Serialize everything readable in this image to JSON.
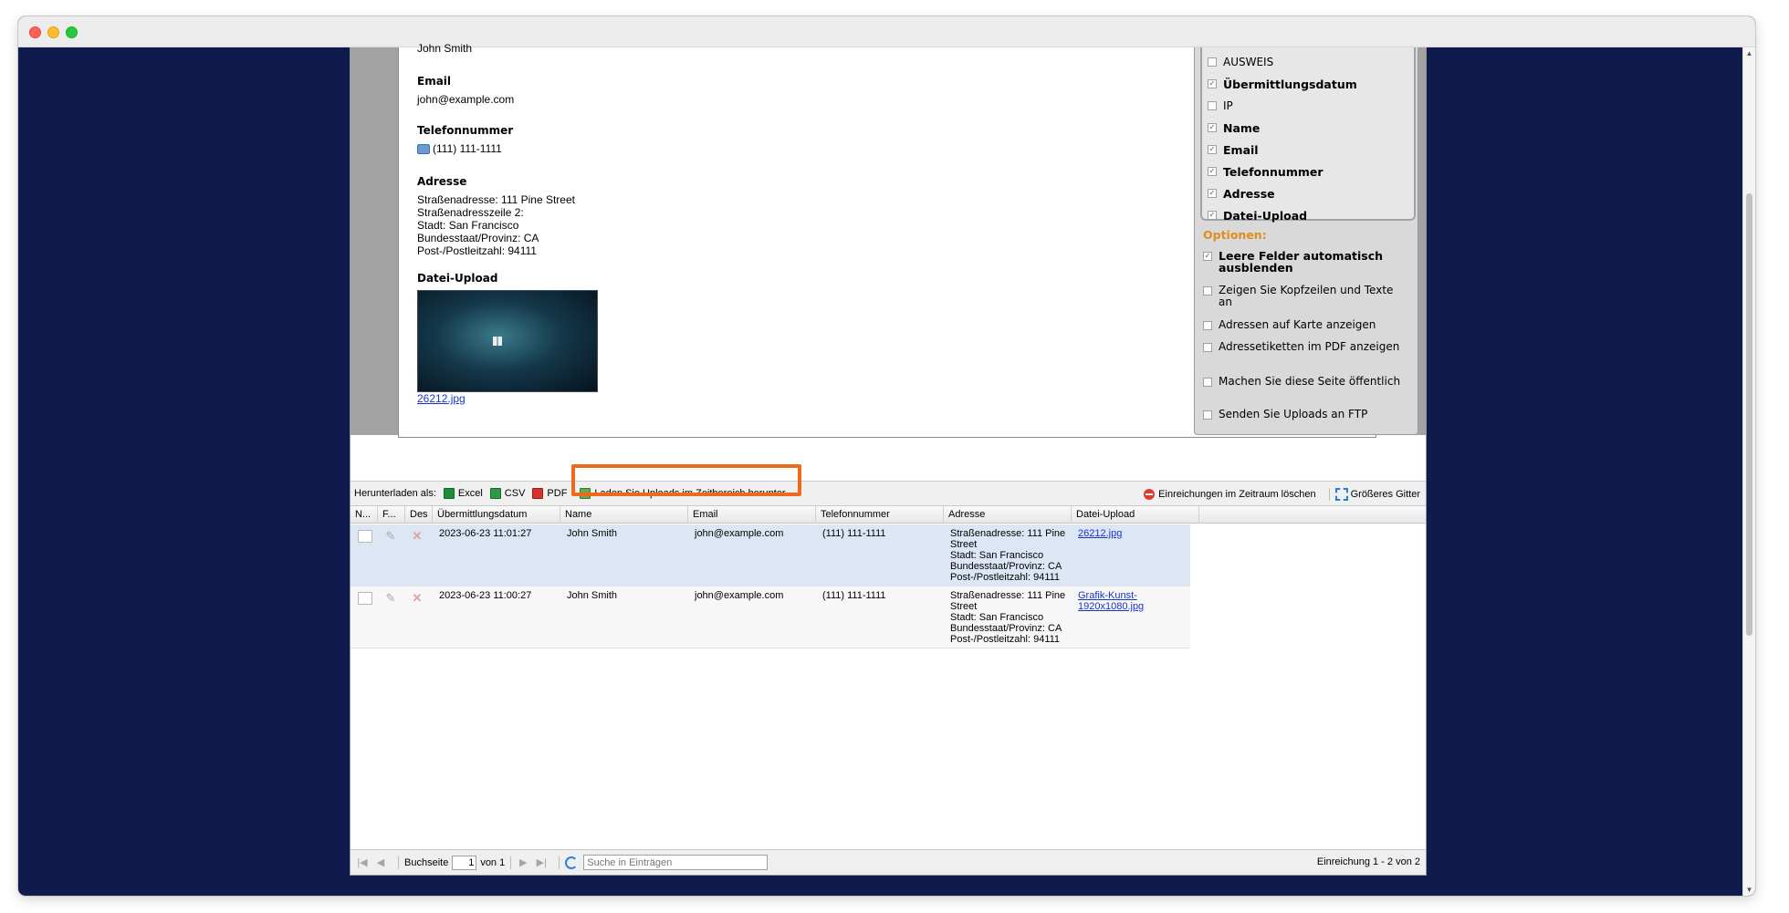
{
  "preview": {
    "name_fragment": "John Smith",
    "fields": [
      {
        "label": "Email",
        "lines": [
          "john@example.com"
        ]
      },
      {
        "label": "Telefonnummer",
        "lines": [
          "(111) 111-1111"
        ]
      },
      {
        "label": "Adresse",
        "lines": [
          "Straßenadresse: 111 Pine Street",
          "Straßenadresszeile 2:",
          "Stadt: San Francisco",
          "Bundesstaat/Provinz: CA",
          "Post-/Postleitzahl: 94111"
        ]
      },
      {
        "label": "Datei-Upload",
        "file_link": "26212.jpg"
      }
    ]
  },
  "side_panel": {
    "fields": [
      {
        "label": "AUSWEIS",
        "checked": false,
        "bold": false
      },
      {
        "label": "Übermittlungsdatum",
        "checked": true,
        "bold": true
      },
      {
        "label": "IP",
        "checked": false,
        "bold": false
      },
      {
        "label": "Name",
        "checked": true,
        "bold": true
      },
      {
        "label": "Email",
        "checked": true,
        "bold": true
      },
      {
        "label": "Telefonnummer",
        "checked": true,
        "bold": true
      },
      {
        "label": "Adresse",
        "checked": true,
        "bold": true
      },
      {
        "label": "Datei-Upload",
        "checked": true,
        "bold": true
      }
    ],
    "options_title": "Optionen:",
    "options": [
      {
        "label": "Leere Felder automatisch ausblenden",
        "checked": true,
        "bold": true
      },
      {
        "label": "Zeigen Sie Kopfzeilen und Texte an",
        "checked": false,
        "bold": false
      },
      {
        "label": "Adressen auf Karte anzeigen",
        "checked": false,
        "bold": false
      },
      {
        "label": "Adressetiketten im PDF anzeigen",
        "checked": false,
        "bold": false
      },
      {
        "label": "Machen Sie diese Seite öffentlich",
        "checked": false,
        "bold": false
      },
      {
        "label": "Senden Sie Uploads an FTP",
        "checked": false,
        "bold": false
      }
    ]
  },
  "toolbar": {
    "download_label": "Herunterladen als:",
    "excel": "Excel",
    "csv": "CSV",
    "pdf": "PDF",
    "uploads": "Laden Sie Uploads im Zeitbereich herunter",
    "delete": "Einreichungen im Zeitraum löschen",
    "bigger_grid": "Größeres Gitter"
  },
  "grid": {
    "columns": [
      "N...",
      "F...",
      "Des",
      "Übermittlungsdatum",
      "Name",
      "Email",
      "Telefonnummer",
      "Adresse",
      "Datei-Upload"
    ],
    "rows": [
      {
        "date": "2023-06-23 11:01:27",
        "name": "John Smith",
        "email": "john@example.com",
        "phone": "(111) 111-1111",
        "address": [
          "Straßenadresse: 111 Pine",
          "Street",
          "Stadt: San Francisco",
          "Bundesstaat/Provinz: CA",
          "Post-/Postleitzahl: 94111"
        ],
        "file": [
          "26212.jpg"
        ]
      },
      {
        "date": "2023-06-23 11:00:27",
        "name": "John Smith",
        "email": "john@example.com",
        "phone": "(111) 111-1111",
        "address": [
          "Straßenadresse: 111 Pine",
          "Street",
          "Stadt: San Francisco",
          "Bundesstaat/Provinz: CA",
          "Post-/Postleitzahl: 94111"
        ],
        "file": [
          "Grafik-Kunst-",
          "1920x1080.jpg"
        ]
      }
    ]
  },
  "pager": {
    "page_label": "Buchseite",
    "page_value": "1",
    "of_label": "von 1",
    "search_placeholder": "Suche in Einträgen",
    "summary": "Einreichung 1 - 2 von 2"
  }
}
